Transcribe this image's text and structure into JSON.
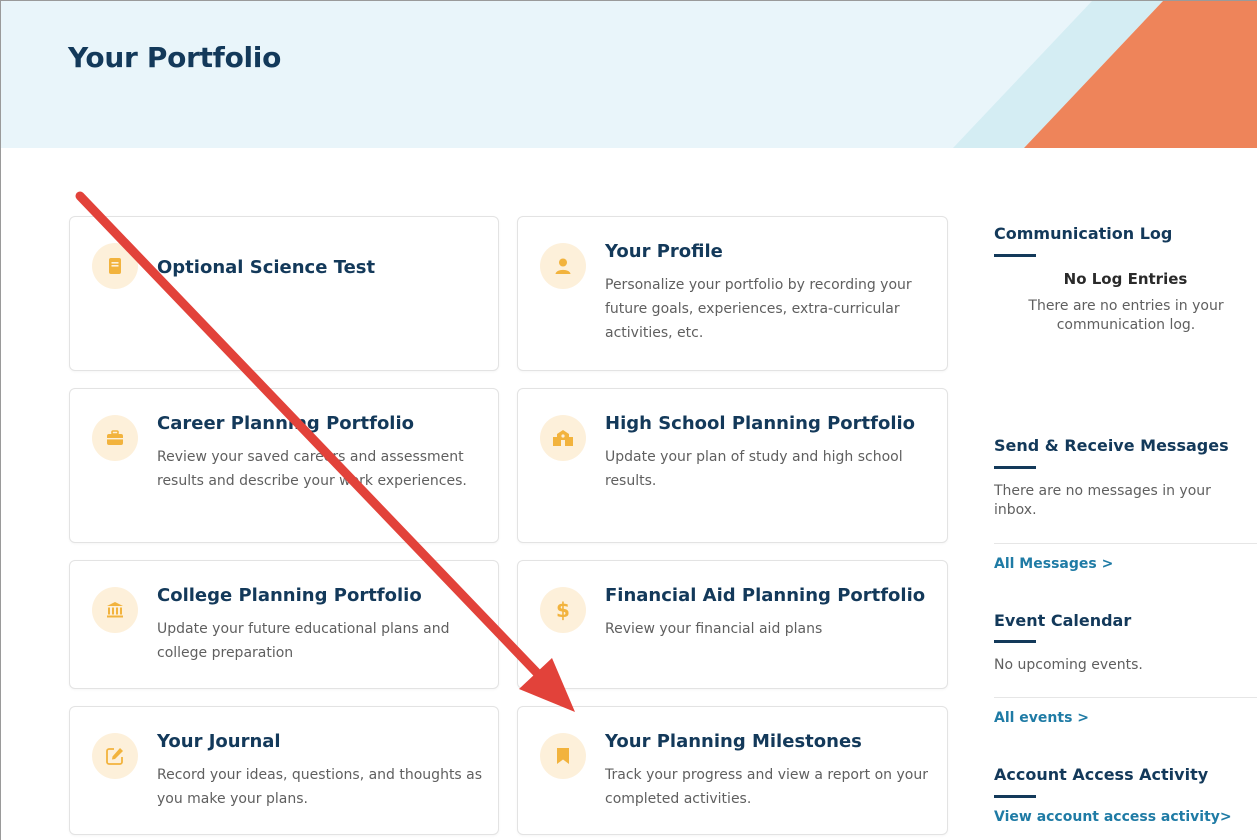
{
  "header": {
    "title": "Your Portfolio"
  },
  "colors": {
    "navy": "#13395a",
    "link": "#1f7ba5",
    "icon_bg": "#fdf0da",
    "icon_fg": "#f2b33d",
    "header_bg": "#e9f5fa",
    "deco_orange": "#ee845a",
    "deco_light": "#d4edf3",
    "arrow": "#e2423a"
  },
  "cards": [
    {
      "title": "Optional Science Test",
      "desc": "",
      "icon": "book-icon"
    },
    {
      "title": "Your Profile",
      "desc": "Personalize your portfolio by recording your future goals, experiences, extra-curricular activities, etc.",
      "icon": "person-icon"
    },
    {
      "title": "Career Planning Portfolio",
      "desc": "Review your saved careers and assessment results and describe your work experiences.",
      "icon": "briefcase-icon"
    },
    {
      "title": "High School Planning Portfolio",
      "desc": "Update your plan of study and high school results.",
      "icon": "school-icon"
    },
    {
      "title": "College Planning Portfolio",
      "desc": "Update your future educational plans and college preparation",
      "icon": "university-icon"
    },
    {
      "title": "Financial Aid Planning Portfolio",
      "desc": "Review your financial aid plans",
      "icon": "dollar-icon"
    },
    {
      "title": "Your Journal",
      "desc": "Record your ideas, questions, and thoughts as you make your plans.",
      "icon": "edit-icon"
    },
    {
      "title": "Your Planning Milestones",
      "desc": "Track your progress and view a report on your completed activities.",
      "icon": "bookmark-icon"
    }
  ],
  "sidebar": {
    "comm_log": {
      "title": "Communication Log",
      "empty_title": "No Log Entries",
      "empty_text": "There are no entries in your communication log."
    },
    "messages": {
      "title": "Send & Receive Messages",
      "text": "There are no messages in your inbox.",
      "link": "All Messages >"
    },
    "events": {
      "title": "Event Calendar",
      "text": "No upcoming events.",
      "link": "All events >"
    },
    "access": {
      "title": "Account Access Activity",
      "link": "View account access activity>"
    }
  }
}
